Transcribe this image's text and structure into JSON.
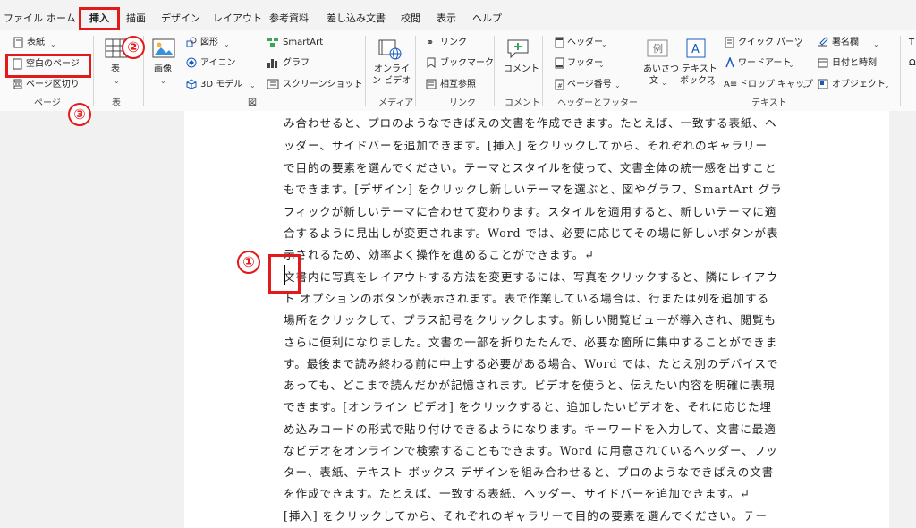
{
  "tabs": [
    {
      "label": "ファイル"
    },
    {
      "label": "ホーム"
    },
    {
      "label": "挿入"
    },
    {
      "label": "描画"
    },
    {
      "label": "デザイン"
    },
    {
      "label": "レイアウト"
    },
    {
      "label": "参考資料"
    },
    {
      "label": "差し込み文書"
    },
    {
      "label": "校閲"
    },
    {
      "label": "表示"
    },
    {
      "label": "ヘルプ"
    }
  ],
  "ribbon": {
    "pages": {
      "cover": "表紙",
      "blank": "空白のページ",
      "break": "ページ区切り",
      "group": "ページ"
    },
    "table": {
      "label": "表",
      "group": "表"
    },
    "illustrations": {
      "picture": "画像",
      "shapes": "図形",
      "icons": "アイコン",
      "model3d": "3D モデル",
      "smartart": "SmartArt",
      "chart": "グラフ",
      "screenshot": "スクリーンショット",
      "group": "図"
    },
    "media": {
      "online_video_1": "オンライ",
      "online_video_2": "ン ビデオ",
      "group": "メディア"
    },
    "links": {
      "link": "リンク",
      "bookmark": "ブックマーク",
      "crossref": "相互参照",
      "group": "リンク"
    },
    "comments": {
      "comment": "コメント",
      "group": "コメント"
    },
    "header_footer": {
      "header": "ヘッダー",
      "footer": "フッター",
      "page_number": "ページ番号",
      "group": "ヘッダーとフッター"
    },
    "text": {
      "greeting_1": "あいさつ",
      "greeting_2": "文",
      "textbox_1": "テキスト",
      "textbox_2": "ボックス",
      "quickparts": "クイック パーツ",
      "wordart": "ワードアート",
      "dropcap": "ドロップ キャップ",
      "signature": "署名欄",
      "datetime": "日付と時刻",
      "object": "オブジェクト",
      "group": "テキスト"
    }
  },
  "callouts": {
    "one": "①",
    "two": "②",
    "three": "③"
  },
  "document": {
    "lines": [
      "み合わせると、プロのようなできばえの文書を作成できます。たとえば、一致する表紙、ヘ",
      "ッダー、サイドバーを追加できます。[挿入] をクリックしてから、それぞれのギャラリー",
      "で目的の要素を選んでください。テーマとスタイルを使って、文書全体の統一感を出すこと",
      "もできます。[デザイン] をクリックし新しいテーマを選ぶと、図やグラフ、SmartArt グラ",
      "フィックが新しいテーマに合わせて変わります。スタイルを適用すると、新しいテーマに適",
      "合するように見出しが変更されます。Word では、必要に応じてその場に新しいボタンが表",
      "示されるため、効率よく操作を進めることができます。↵",
      "文書内に写真をレイアウトする方法を変更するには、写真をクリックすると、隣にレイアウ",
      "ト オプションのボタンが表示されます。表で作業している場合は、行または列を追加する",
      "場所をクリックして、プラス記号をクリックします。新しい閲覧ビューが導入され、閲覧も",
      "さらに便利になりました。文書の一部を折りたたんで、必要な箇所に集中することができま",
      "す。最後まで読み終わる前に中止する必要がある場合、Word では、たとえ別のデバイスで",
      "あっても、どこまで読んだかが記憶されます。ビデオを使うと、伝えたい内容を明確に表現",
      "できます。[オンライン ビデオ] をクリックすると、追加したいビデオを、それに応じた埋",
      "め込みコードの形式で貼り付けできるようになります。キーワードを入力して、文書に最適",
      "なビデオをオンラインで検索することもできます。Word に用意されているヘッダー、フッ",
      "ター、表紙、テキスト ボックス デザインを組み合わせると、プロのようなできばえの文書",
      "を作成できます。たとえば、一致する表紙、ヘッダー、サイドバーを追加できます。↵",
      "[挿入] をクリックしてから、それぞれのギャラリーで目的の要素を選んでください。テー"
    ]
  },
  "colors": {
    "accent": "#185abd",
    "callout": "#e21a1a"
  }
}
